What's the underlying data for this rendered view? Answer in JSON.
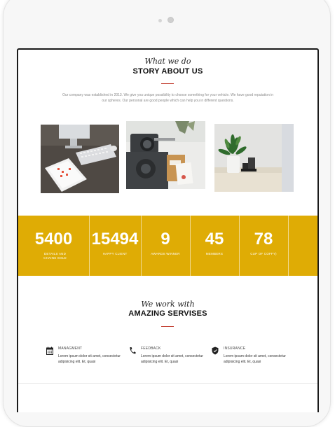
{
  "about": {
    "eyebrow": "What we do",
    "title": "STORY ABOUT US",
    "text": "Our company was established in 2013. We give you unique possibility to choose something for your vehicle. We have good reputation in our spheres. Our personal are good people which can help you in different questions."
  },
  "photos": [
    {
      "icon": "desk-workspace-photo"
    },
    {
      "icon": "camera-notebook-photo"
    },
    {
      "icon": "plant-office-photo"
    }
  ],
  "stats": [
    {
      "value": "5400",
      "label": "DETAILS AND CHAINS SOLD"
    },
    {
      "value": "15494",
      "label": "HAPPY CLIENT"
    },
    {
      "value": "9",
      "label": "AWARDS WINNER"
    },
    {
      "value": "45",
      "label": "MEMBERS"
    },
    {
      "value": "78",
      "label": "CUP OF COFFY)"
    }
  ],
  "services_heading": {
    "eyebrow": "We work with",
    "title": "AMAZING SERVISES"
  },
  "services": [
    {
      "icon": "calendar-icon",
      "title": "MANAGMENT",
      "text": "Lorem ipsum dolor sit amet, consectetur adipisicing elit. Et, quasi"
    },
    {
      "icon": "phone-icon",
      "title": "FEEDBACK",
      "text": "Lorem ipsum dolor sit amet, consectetur adipisicing elit. Et, quasi"
    },
    {
      "icon": "shield-icon",
      "title": "INSURANCE",
      "text": "Lorem ipsum dolor sit amet, consectetur adipisicing elit. Et, quasi"
    }
  ],
  "colors": {
    "accent": "#dfac05",
    "rule": "#c0392b"
  }
}
